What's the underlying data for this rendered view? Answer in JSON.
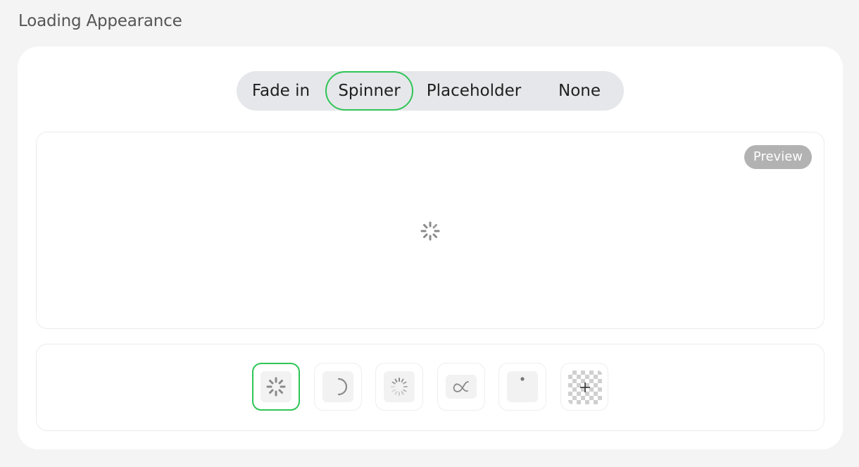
{
  "section": {
    "title": "Loading Appearance"
  },
  "tabs": [
    {
      "label": "Fade in",
      "selected": false
    },
    {
      "label": "Spinner",
      "selected": true
    },
    {
      "label": "Placeholder",
      "selected": false
    },
    {
      "label": "None",
      "selected": false
    }
  ],
  "preview": {
    "badge": "Preview",
    "icon": "spinner-dots-icon"
  },
  "spinner_options": [
    {
      "icon": "spinner-dots-icon",
      "selected": true
    },
    {
      "icon": "spinner-arc-icon",
      "selected": false
    },
    {
      "icon": "spinner-ring-dots-icon",
      "selected": false
    },
    {
      "icon": "spinner-infinity-icon",
      "selected": false
    },
    {
      "icon": "spinner-single-dot-icon",
      "selected": false
    },
    {
      "icon": "custom-upload-plus-icon",
      "selected": false
    }
  ],
  "colors": {
    "accent": "#2fc556",
    "badge": "#b2b2b2",
    "segment_bg": "#e6e7ea"
  }
}
